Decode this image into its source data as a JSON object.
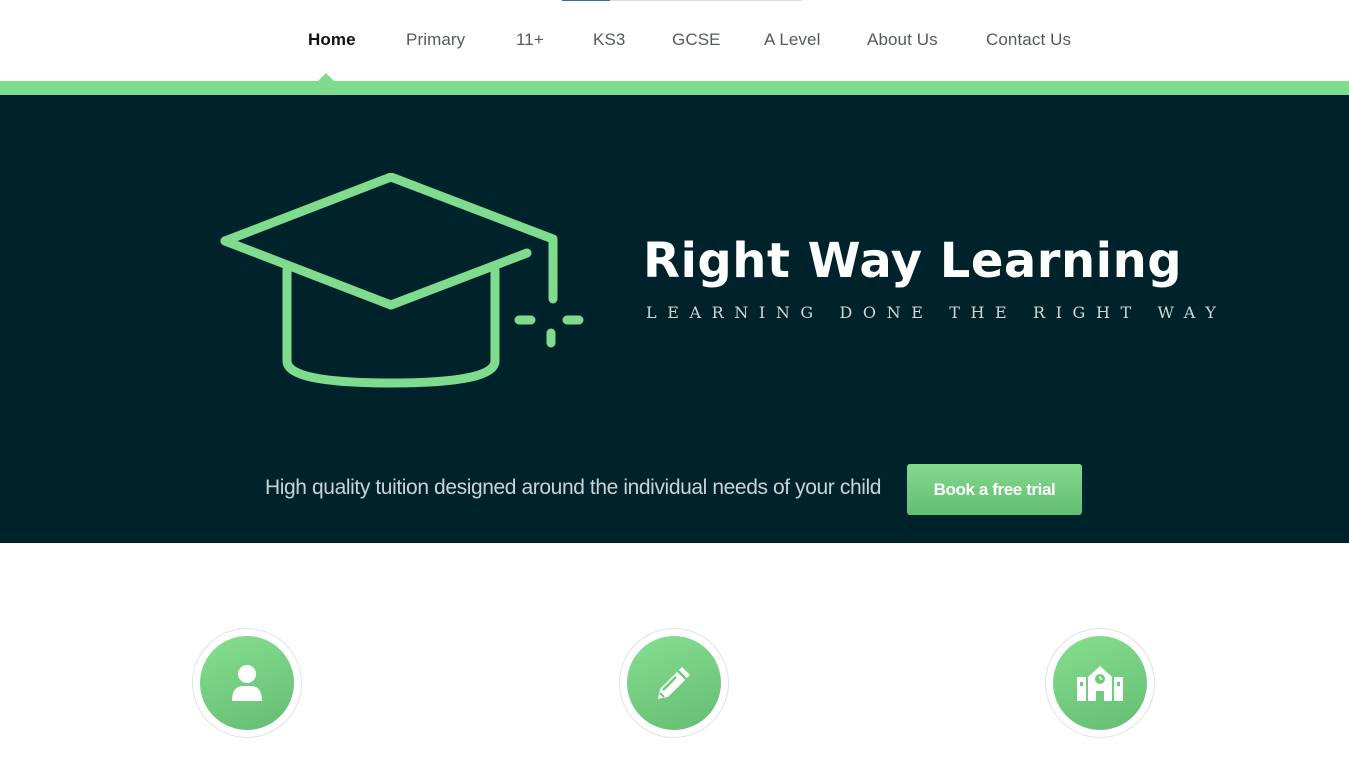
{
  "nav": {
    "items": [
      {
        "label": "Home",
        "active": true
      },
      {
        "label": "Primary",
        "active": false
      },
      {
        "label": "11+",
        "active": false
      },
      {
        "label": "KS3",
        "active": false
      },
      {
        "label": "GCSE",
        "active": false
      },
      {
        "label": "A Level",
        "active": false
      },
      {
        "label": "About Us",
        "active": false
      },
      {
        "label": "Contact Us",
        "active": false
      }
    ]
  },
  "hero": {
    "logo_icon": "graduation-cap-icon",
    "title": "Right Way Learning",
    "tagline": "LEARNING DONE THE RIGHT WAY",
    "description": "High quality tuition designed around the individual needs of your child",
    "cta_label": "Book a free trial"
  },
  "features": [
    {
      "icon": "user-icon"
    },
    {
      "icon": "pencil-icon"
    },
    {
      "icon": "school-icon"
    }
  ],
  "colors": {
    "accent_green": "#7fdb8d",
    "hero_background": "#00232b",
    "nav_text": "#555a5e",
    "nav_active_text": "#111111"
  }
}
